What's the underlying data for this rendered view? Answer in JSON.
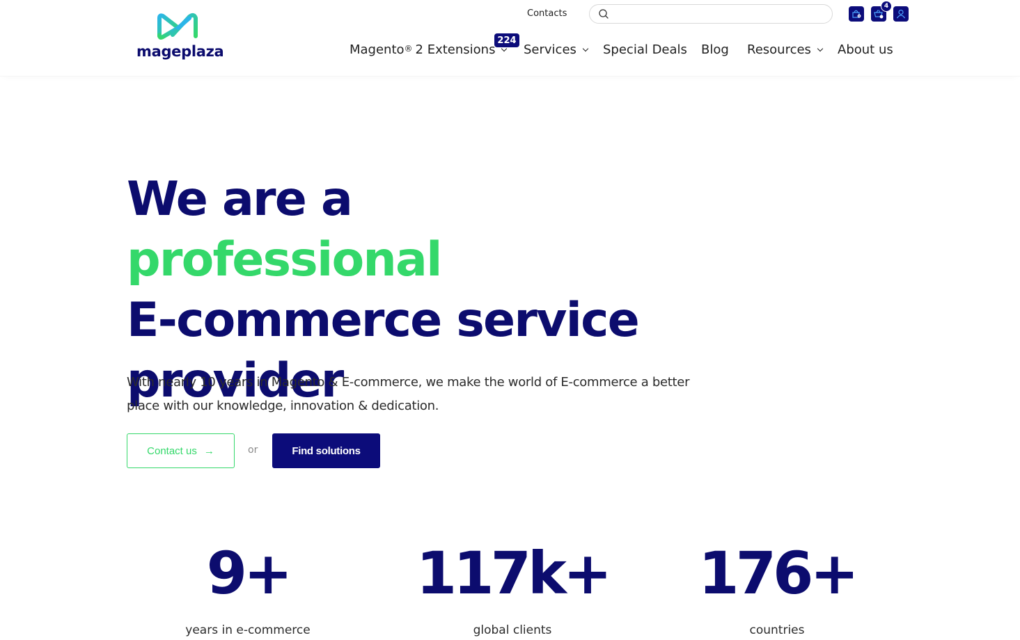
{
  "brand": {
    "name": "mageplaza",
    "logo_colors": {
      "green": "#34d86a",
      "blue": "#2bb5e8",
      "navy": "#0c0c6e"
    }
  },
  "topbar": {
    "contacts_label": "Contacts",
    "search": {
      "placeholder": "",
      "value": "",
      "icon": "search-icon"
    },
    "icons": [
      {
        "name": "wishlist-bag-icon"
      },
      {
        "name": "cart-icon",
        "badge": "4"
      },
      {
        "name": "account-icon"
      }
    ]
  },
  "nav": {
    "items": [
      {
        "label": "Magento",
        "sup": "®",
        "label_rest": "2 Extensions",
        "badge": "224",
        "has_dropdown": true
      },
      {
        "label": "Services",
        "has_dropdown": true
      },
      {
        "label": "Special Deals",
        "has_dropdown": false
      },
      {
        "label": "Blog",
        "has_dropdown": false
      },
      {
        "label": "Resources",
        "has_dropdown": true
      },
      {
        "label": "About us",
        "has_dropdown": false
      }
    ]
  },
  "hero": {
    "title_part1": "We are a ",
    "title_accent": "professional",
    "title_part2": "E-commerce service provider",
    "description": "With nearly 10 years in Magento & E-commerce, we make the world of E-commerce a better place with our knowledge, innovation & dedication.",
    "contact_button": "Contact us",
    "contact_arrow": "→",
    "or_text": "or",
    "find_button": "Find solutions"
  },
  "stats": [
    {
      "value": "9+",
      "label": "years in e-commerce"
    },
    {
      "value": "117k+",
      "label": "global clients"
    },
    {
      "value": "176+",
      "label": "countries"
    }
  ],
  "colors": {
    "navy": "#0c0c7a",
    "accent_green": "#34d86a",
    "text": "#1f1f1f"
  }
}
